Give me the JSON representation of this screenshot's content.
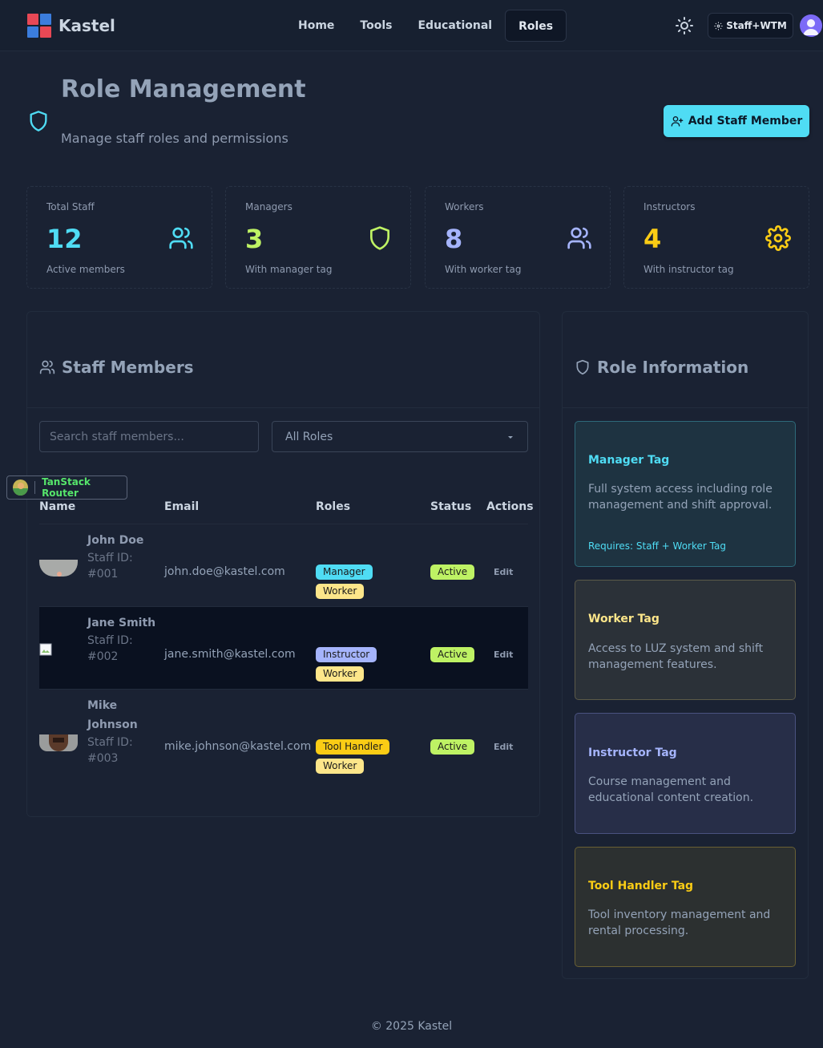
{
  "app": {
    "name": "Kastel",
    "logo_colors": [
      "#e84855",
      "#3b7ddd",
      "#3b7ddd",
      "#e84855"
    ]
  },
  "nav": {
    "links": [
      {
        "label": "Home",
        "active": false
      },
      {
        "label": "Tools",
        "active": false
      },
      {
        "label": "Educational",
        "active": false
      },
      {
        "label": "Roles",
        "active": true
      }
    ],
    "theme_icon": "sun-icon",
    "user_badge": "Staff+WTM"
  },
  "header": {
    "title": "Role Management",
    "subtitle": "Manage staff roles and permissions",
    "add_button": "Add Staff Member"
  },
  "stats": [
    {
      "label": "Total Staff",
      "value": "12",
      "desc": "Active members",
      "color": "#4fdcf4",
      "icon": "users-icon"
    },
    {
      "label": "Managers",
      "value": "3",
      "desc": "With manager tag",
      "color": "#bef264",
      "icon": "shield-icon"
    },
    {
      "label": "Workers",
      "value": "8",
      "desc": "With worker tag",
      "color": "#a5b4fc",
      "icon": "users-icon"
    },
    {
      "label": "Instructors",
      "value": "4",
      "desc": "With instructor tag",
      "color": "#facc15",
      "icon": "gear-icon"
    }
  ],
  "staff": {
    "title": "Staff Members",
    "search_placeholder": "Search staff members...",
    "role_filter": "All Roles",
    "columns": [
      "Name",
      "Email",
      "Roles",
      "Status",
      "Actions"
    ],
    "rows": [
      {
        "name": "John Doe",
        "id_label": "Staff ID:",
        "id": "#001",
        "email": "john.doe@kastel.com",
        "roles": [
          "Manager",
          "Worker"
        ],
        "status": "Active",
        "action": "Edit"
      },
      {
        "name": "Jane Smith",
        "id_label": "Staff ID:",
        "id": "#002",
        "email": "jane.smith@kastel.com",
        "roles": [
          "Instructor",
          "Worker"
        ],
        "status": "Active",
        "action": "Edit"
      },
      {
        "name_line1": "Mike",
        "name_line2": "Johnson",
        "id_label": "Staff ID:",
        "id": "#003",
        "email": "mike.johnson@kastel.com",
        "roles": [
          "Tool Handler",
          "Worker"
        ],
        "status": "Active",
        "action": "Edit"
      }
    ]
  },
  "devtools": {
    "label": "TanStack Router"
  },
  "role_info": {
    "title": "Role Information",
    "cards": [
      {
        "title": "Manager Tag",
        "desc": "Full system access including role management and shift approval.",
        "req": "Requires: Staff + Worker Tag",
        "accent": "#4fdcf4"
      },
      {
        "title": "Worker Tag",
        "desc": "Access to LUZ system and shift management features.",
        "accent": "#fde68a"
      },
      {
        "title": "Instructor Tag",
        "desc": "Course management and educational content creation.",
        "accent": "#a5b4fc"
      },
      {
        "title": "Tool Handler Tag",
        "desc": "Tool inventory management and rental processing.",
        "accent": "#facc15"
      }
    ]
  },
  "footer": "© 2025 Kastel"
}
